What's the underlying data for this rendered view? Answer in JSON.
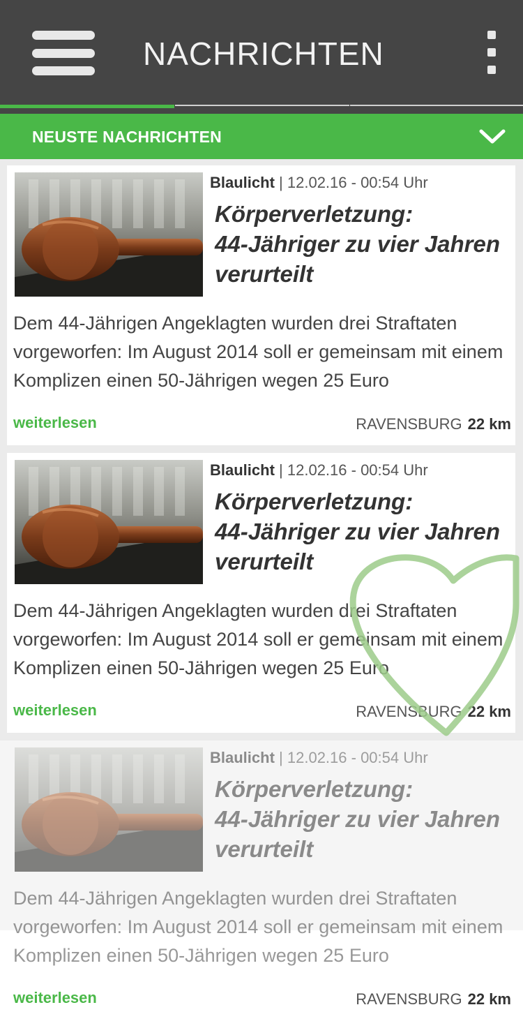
{
  "header": {
    "title": "NACHRICHTEN"
  },
  "section": {
    "label": "NEUSTE NACHRICHTEN"
  },
  "articles": [
    {
      "category": "Blaulicht",
      "separator": "|",
      "date": "12.02.16 - 00:54 Uhr",
      "headline_line1": "Körperverletzung:",
      "headline_line2": "44-Jähriger zu vier Jahren",
      "headline_line3": "verurteilt",
      "excerpt": "Dem 44-Jährigen Angeklagten wurden drei Straftaten vorgeworfen: Im August 2014 soll er gemeinsam mit einem Komplizen einen 50-Jährigen wegen 25 Euro",
      "read_more": "weiterlesen",
      "location": "RAVENSBURG",
      "distance": "22 km"
    },
    {
      "category": "Blaulicht",
      "separator": "|",
      "date": "12.02.16 - 00:54 Uhr",
      "headline_line1": "Körperverletzung:",
      "headline_line2": "44-Jähriger zu vier Jahren",
      "headline_line3": "verurteilt",
      "excerpt": "Dem 44-Jährigen Angeklagten wurden drei Straftaten vorgeworfen: Im August 2014 soll er gemeinsam mit einem Komplizen einen 50-Jährigen wegen 25 Euro",
      "read_more": "weiterlesen",
      "location": "RAVENSBURG",
      "distance": "22 km"
    },
    {
      "category": "Blaulicht",
      "separator": "|",
      "date": "12.02.16 - 00:54 Uhr",
      "headline_line1": "Körperverletzung:",
      "headline_line2": "44-Jähriger zu vier Jahren",
      "headline_line3": "verurteilt",
      "excerpt": "Dem 44-Jährigen Angeklagten wurden drei Straftaten vorgeworfen: Im August 2014 soll er gemeinsam mit einem Komplizen einen 50-Jährigen wegen 25 Euro",
      "read_more": "weiterlesen",
      "location": "RAVENSBURG",
      "distance": "22 km"
    }
  ],
  "colors": {
    "accent": "#4ab848",
    "header_bg": "#454545",
    "heart": "#9ccb8a"
  },
  "icons": {
    "menu": "hamburger-icon",
    "more": "kebab-icon",
    "expand": "chevron-down-icon",
    "thumbnail": "gavel-image",
    "overlay": "heart-outline-icon"
  }
}
